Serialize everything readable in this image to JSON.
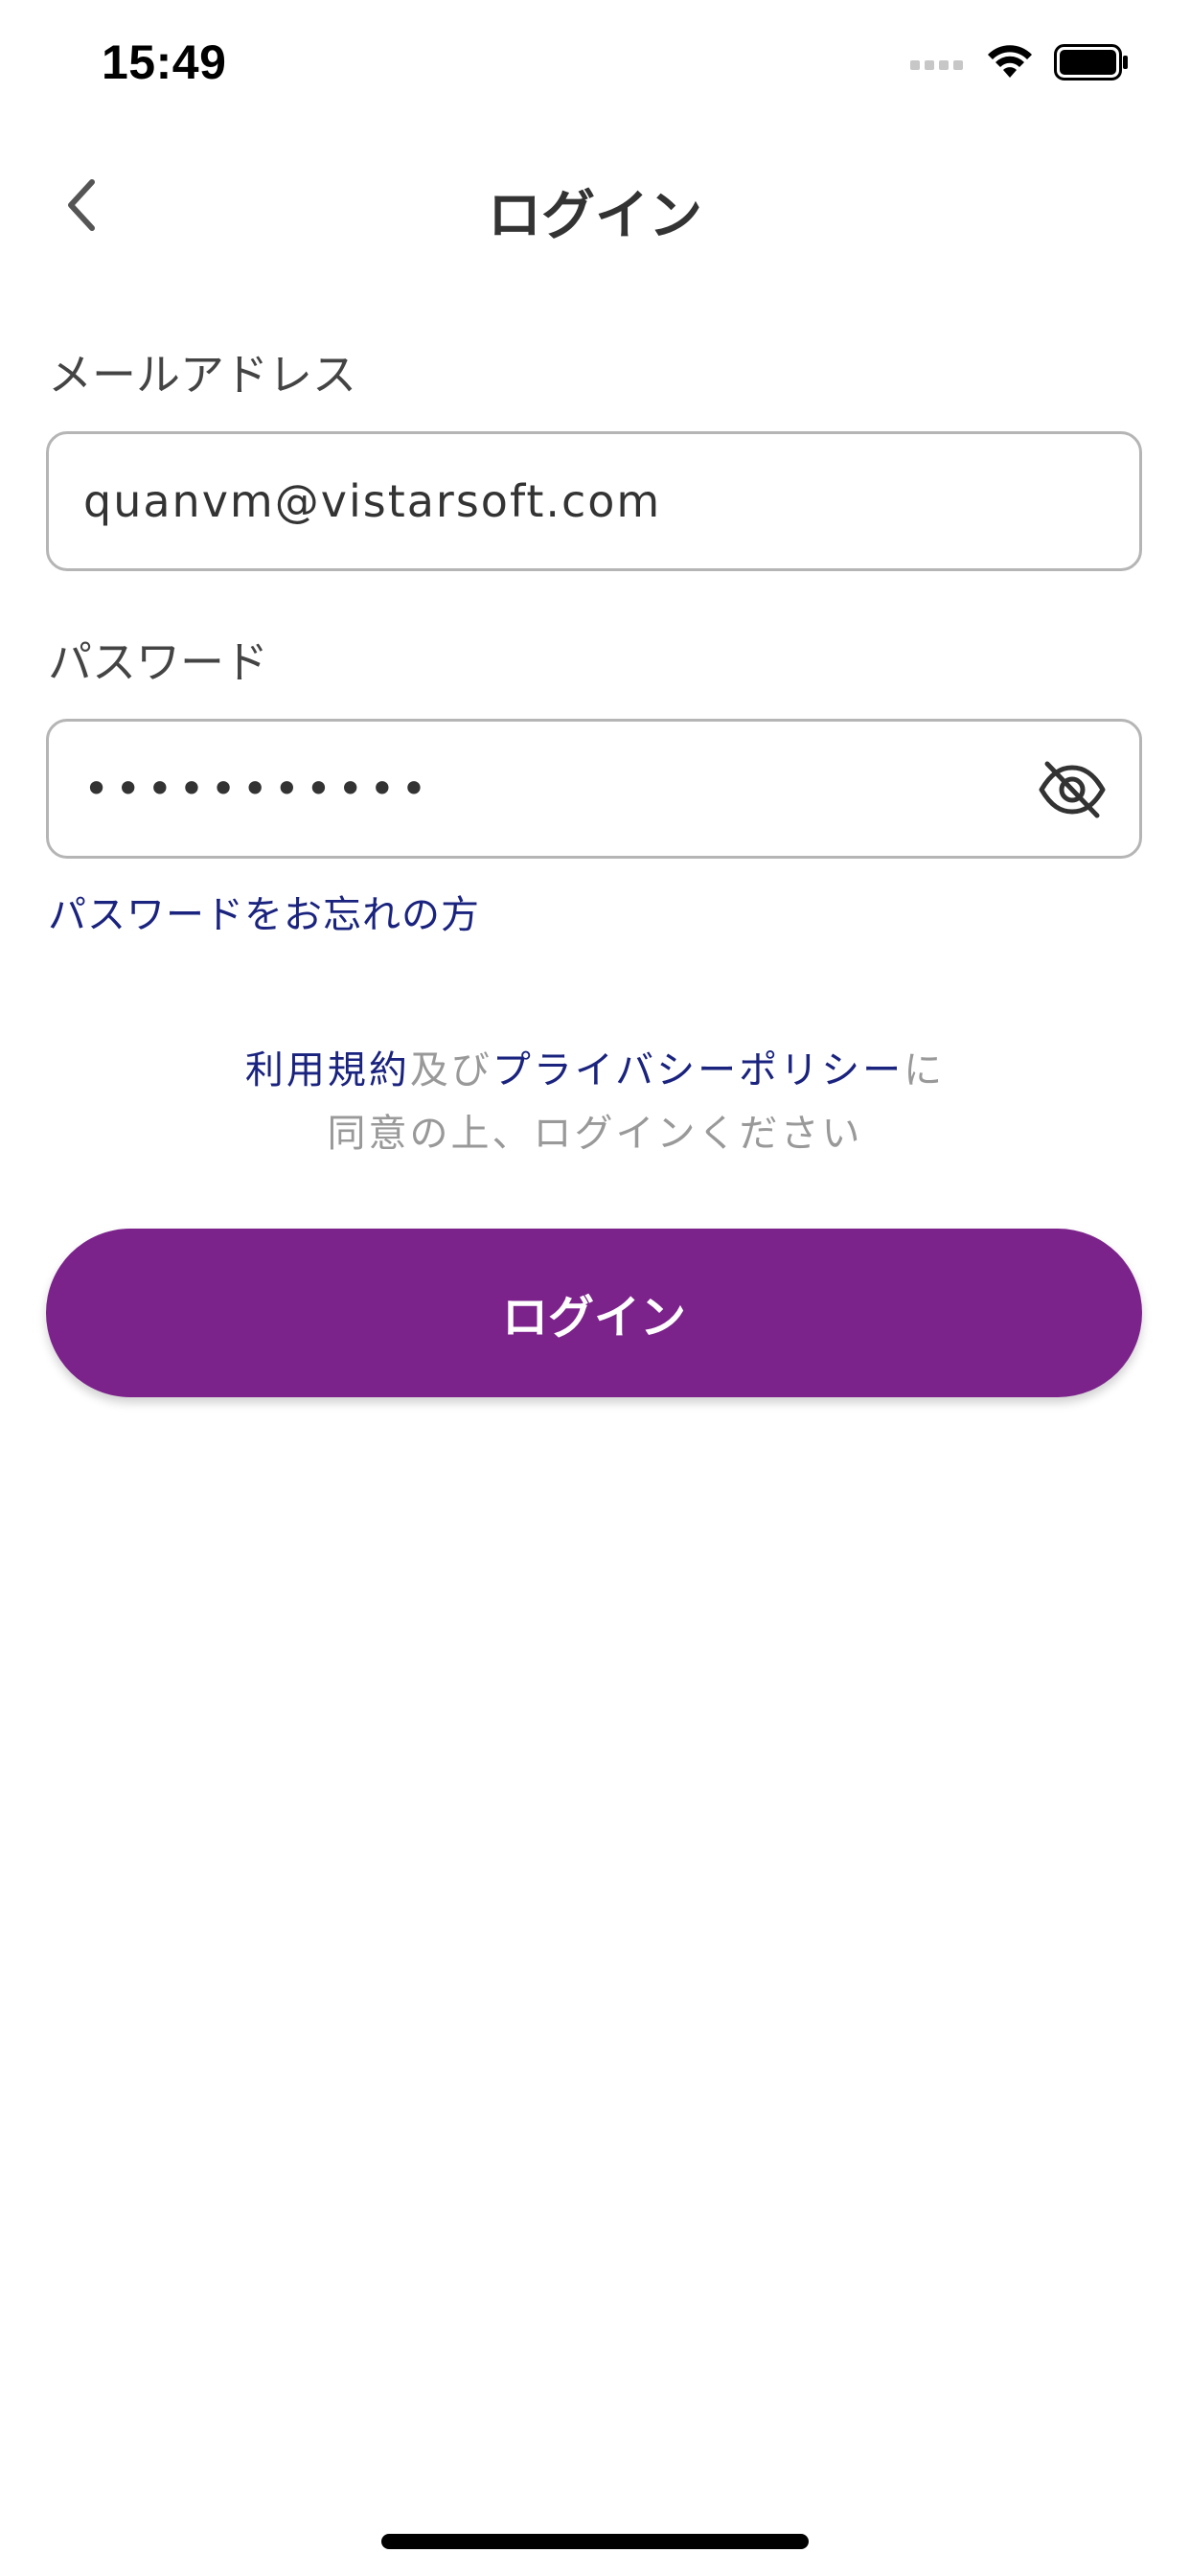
{
  "status_bar": {
    "time": "15:49",
    "signal_icon": "cellular-signal-icon",
    "wifi_icon": "wifi-icon",
    "battery_icon": "battery-icon"
  },
  "header": {
    "title": "ログイン",
    "back_icon": "chevron-left-icon"
  },
  "form": {
    "email": {
      "label": "メールアドレス",
      "value": "quanvm@vistarsoft.com"
    },
    "password": {
      "label": "パスワード",
      "value": "•••••••••••",
      "toggle_icon": "eye-off-icon"
    },
    "forgot_password": "パスワードをお忘れの方"
  },
  "terms": {
    "terms_link": "利用規約",
    "conjunction": "及び",
    "privacy_link": "プライバシーポリシー",
    "particle": "に",
    "line2": "同意の上、ログインください"
  },
  "login_button": {
    "label": "ログイン"
  },
  "colors": {
    "accent": "#7b228b",
    "link": "#1a237e",
    "muted": "#999999",
    "border": "#b5b5b5"
  }
}
